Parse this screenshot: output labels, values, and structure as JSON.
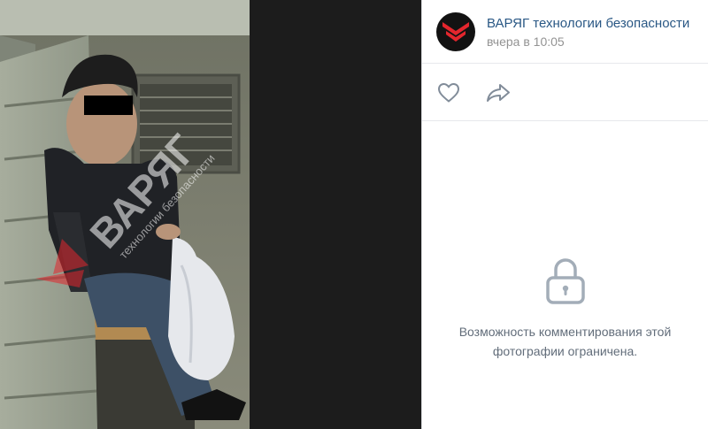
{
  "post": {
    "author": "ВАРЯГ технологии безопасности",
    "time": "вчера в 10:05"
  },
  "photo": {
    "watermark_brand": "ВАРЯГ",
    "watermark_tagline": "технологии безопасности"
  },
  "icons": {
    "avatar_logo": "chevron-logo",
    "like": "heart-icon",
    "share": "share-arrow-icon",
    "lock": "lock-icon"
  },
  "comments": {
    "restricted_line1": "Возможность комментирования этой",
    "restricted_line2": "фотографии ограничена."
  },
  "colors": {
    "link": "#2a5885",
    "muted": "#939393",
    "icon": "#818c99",
    "brand_red": "#e3262d"
  }
}
